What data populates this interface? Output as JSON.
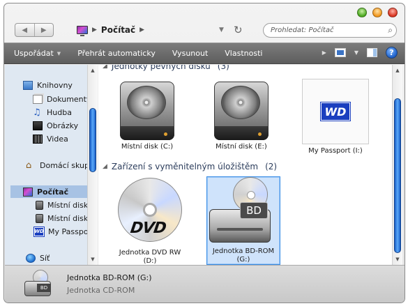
{
  "window": {
    "title": "Počítač"
  },
  "address": {
    "location": "Počítač"
  },
  "search": {
    "placeholder": "Prohledat: Počítač"
  },
  "toolbar": {
    "organize": "Uspořádat",
    "autoplay": "Přehrát automaticky",
    "eject": "Vysunout",
    "properties": "Vlastnosti"
  },
  "sidebar": {
    "items": [
      {
        "label": "Knihovny",
        "icon": "library-icon"
      },
      {
        "label": "Dokumenty",
        "icon": "document-icon"
      },
      {
        "label": "Hudba",
        "icon": "music-icon"
      },
      {
        "label": "Obrázky",
        "icon": "pictures-icon"
      },
      {
        "label": "Videa",
        "icon": "video-icon"
      },
      {
        "label": "Domácí skupina",
        "icon": "homegroup-icon"
      },
      {
        "label": "Počítač",
        "icon": "computer-icon"
      },
      {
        "label": "Místní disk",
        "icon": "hard-disk-icon"
      },
      {
        "label": "Místní disk",
        "icon": "hard-disk-icon"
      },
      {
        "label": "My Passport",
        "icon": "wd-icon"
      },
      {
        "label": "Síť",
        "icon": "network-icon"
      }
    ]
  },
  "main": {
    "groups": [
      {
        "title": "Jednotky pevných disků",
        "count": "(3)"
      },
      {
        "title": "Zařízení s vyměnitelným úložištěm",
        "count": "(2)"
      }
    ],
    "drives": [
      {
        "label": "Místní disk (C:)"
      },
      {
        "label": "Místní disk (E:)"
      },
      {
        "label": "My Passport (I:)",
        "logo_text": "WD"
      },
      {
        "label": "Jednotka DVD RW (D:)",
        "logo_text": "DVD"
      },
      {
        "label": "Jednotka BD-ROM (G:)",
        "logo_text": "BD"
      }
    ]
  },
  "details": {
    "name": "Jednotka BD-ROM (G:)",
    "type": "Jednotka CD-ROM",
    "icon_text": "BD"
  },
  "colors": {
    "toolbar": "#6b6b6b",
    "sidebar": "#dfe8f2",
    "selection": "#cfe3fb",
    "scroll_thumb": "#2a7ae0"
  }
}
